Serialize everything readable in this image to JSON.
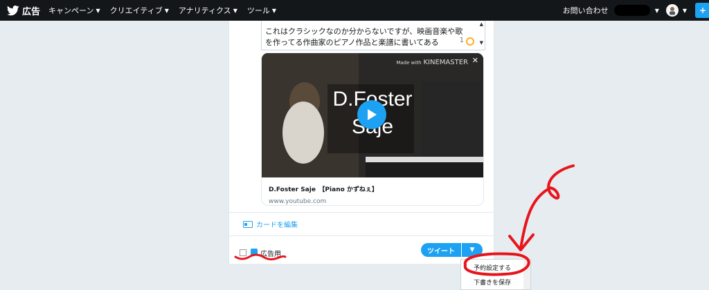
{
  "topbar": {
    "brand_label": "広告",
    "menu": [
      {
        "label": "キャンペーン"
      },
      {
        "label": "クリエイティブ"
      },
      {
        "label": "アナリティクス"
      },
      {
        "label": "ツール"
      }
    ],
    "contact_label": "お問い合わせ"
  },
  "compose": {
    "text": "これはクラシックなのか分からないですが、映画音楽や歌\nを作ってる作曲家のピアノ作品と楽譜に書いてある",
    "char_count": "1",
    "card": {
      "watermark_small": "Made with",
      "watermark_big": "KINEMASTER",
      "video_title_line1": "D.Foster",
      "video_title_line2": "Saje",
      "title": "D.Foster Saje　【Piano かずねぇ】",
      "domain": "www.youtube.com"
    },
    "edit_card_label": "カードを編集",
    "promoted_label": "広告用",
    "tweet_button_label": "ツイート"
  },
  "dropdown": {
    "items": [
      {
        "label": "予約設定する"
      },
      {
        "label": "下書きを保存"
      }
    ]
  },
  "colors": {
    "accent": "#1da1f2",
    "topbar": "#14171a",
    "annotation": "#e8141c"
  }
}
